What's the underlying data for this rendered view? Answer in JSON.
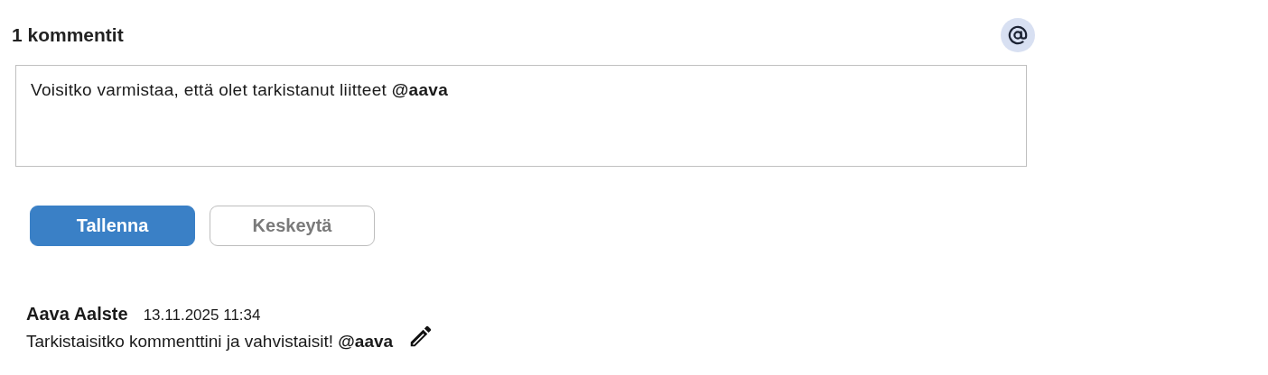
{
  "header": {
    "title": "1 kommentit"
  },
  "editor": {
    "value": "Voisitko varmistaa, että olet tarkistanut liitteet **@aava**"
  },
  "buttons": [
    {
      "label": "Tallenna",
      "kind": "primary"
    },
    {
      "label": "Keskeytä",
      "kind": "secondary"
    }
  ],
  "comments": [
    {
      "author": "Aava Aalste",
      "time": "13.11.2025 11:34",
      "text": "Tarkistaisitko kommenttini ja vahvistaisit! **@aava**"
    }
  ]
}
